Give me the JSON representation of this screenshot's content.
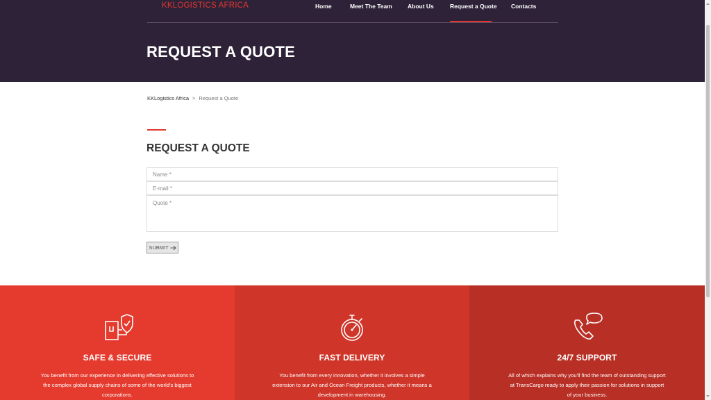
{
  "brand": "KKLOGISTICS AFRICA",
  "nav": {
    "items": [
      {
        "label": "Home"
      },
      {
        "label": "Meet The Team"
      },
      {
        "label": "About Us"
      },
      {
        "label": "Request a Quote"
      },
      {
        "label": "Contacts"
      }
    ],
    "active": "Request a Quote"
  },
  "page_title": "REQUEST A QUOTE",
  "breadcrumb": {
    "home": "KKLogistics Africa",
    "separator": ">",
    "current": "Request a Quote"
  },
  "form": {
    "title": "REQUEST A QUOTE",
    "name_placeholder": "Name *",
    "email_placeholder": "E-mail *",
    "quote_placeholder": "Quote *",
    "submit_label": "SUBMIT"
  },
  "features": [
    {
      "icon": "secure-box-icon",
      "title": "SAFE & SECURE",
      "text": "You benefit from our experience in delivering effective solutions to the complex global supply chains of some of the world's biggest corporations."
    },
    {
      "icon": "stopwatch-icon",
      "title": "FAST DELIVERY",
      "text": "You benefit from every innovation, whether it involves a simple extension to our Air and Ocean Freight products, whether it means a development in warehousing."
    },
    {
      "icon": "phone-support-icon",
      "title": "24/7 SUPPORT",
      "text": "All of which explains why you'll find the team of outstanding support at TransCargo ready to apply their passion for solutions in support of your business."
    }
  ],
  "colors": {
    "header_bg": "#2e2239",
    "accent": "#e2372d",
    "feature_1": "#e53b2f",
    "feature_2": "#cf3529",
    "feature_3": "#b82f25"
  }
}
